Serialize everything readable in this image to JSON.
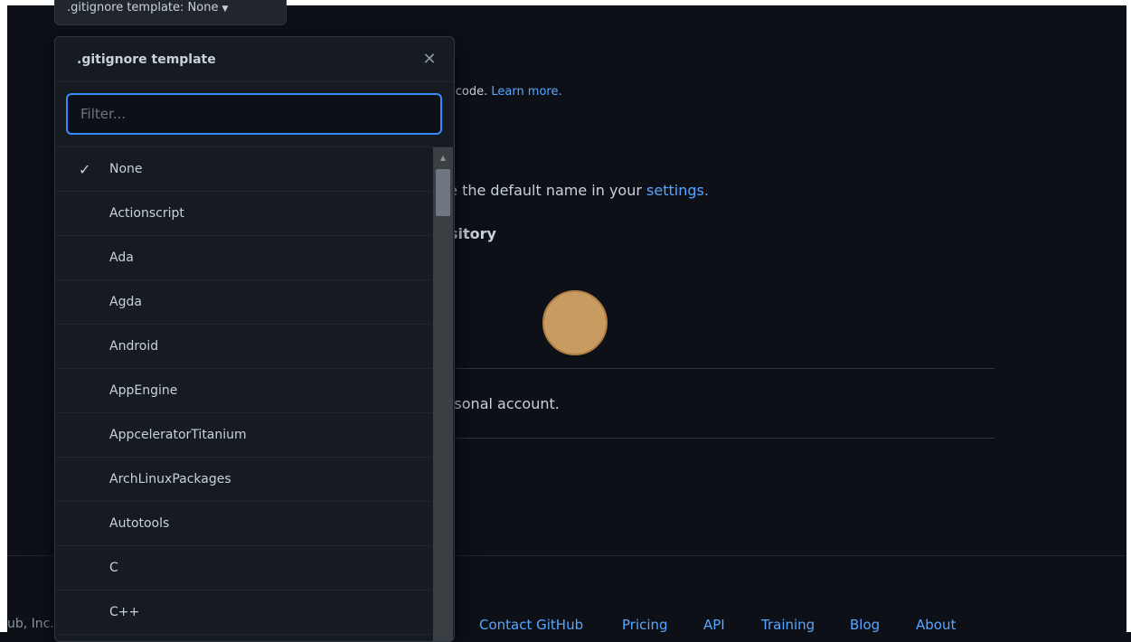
{
  "toggle": {
    "label": ".gitignore template: None"
  },
  "background": {
    "code_text": "ur code.",
    "learn_more": "Learn more.",
    "default_branch_text": "ge the default name in your",
    "settings_link": "settings.",
    "repo_heading": "ository",
    "account_text": "ersonal account."
  },
  "dropdown": {
    "title": ".gitignore template",
    "filter_placeholder": "Filter...",
    "selected": "None",
    "items": [
      "None",
      "Actionscript",
      "Ada",
      "Agda",
      "Android",
      "AppEngine",
      "AppceleratorTitanium",
      "ArchLinuxPackages",
      "Autotools",
      "C",
      "C++"
    ]
  },
  "footer": {
    "copyright": "ub, Inc.",
    "links": [
      "Contact GitHub",
      "Pricing",
      "API",
      "Training",
      "Blog",
      "About"
    ]
  }
}
